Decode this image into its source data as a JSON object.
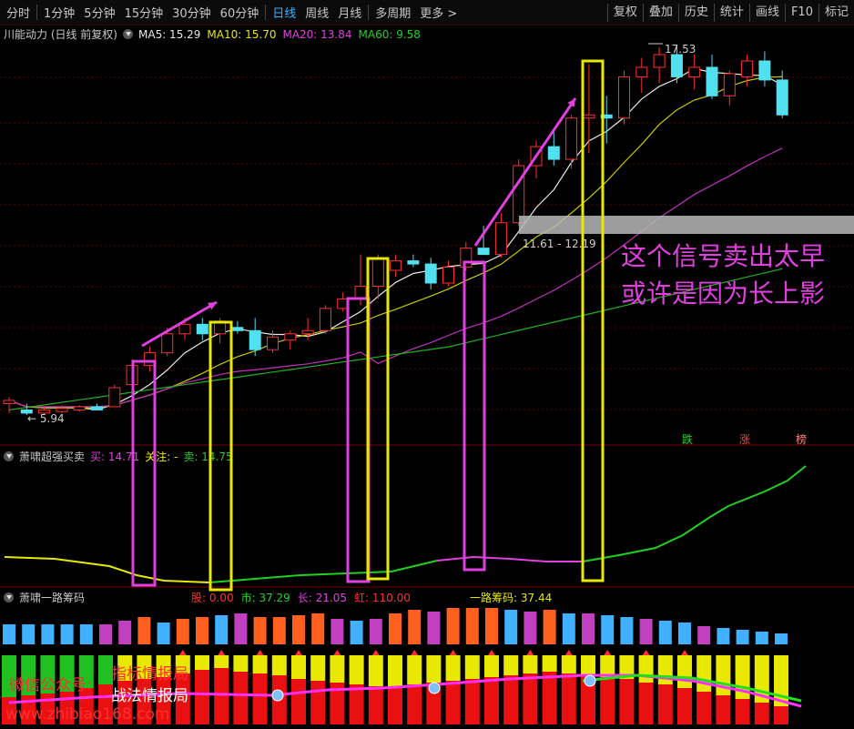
{
  "toolbar": {
    "periods": [
      "分时",
      "1分钟",
      "5分钟",
      "15分钟",
      "30分钟",
      "60分钟",
      "日线",
      "周线",
      "月线",
      "多周期",
      "更多 >"
    ],
    "active_period": "日线",
    "right_buttons": [
      "复权",
      "叠加",
      "历史",
      "统计",
      "画线",
      "F10",
      "标记"
    ]
  },
  "main_panel": {
    "title": "川能动力 (日线 前复权)",
    "ma": [
      {
        "label": "MA5: 15.29",
        "color": "#e8e8e8"
      },
      {
        "label": "MA10: 15.70",
        "color": "#e8e800"
      },
      {
        "label": "MA20: 13.84",
        "color": "#e040e0"
      },
      {
        "label": "MA60: 9.58",
        "color": "#20d020"
      }
    ],
    "high_label": "17.53",
    "low_label": "← 5.94",
    "range_label": "11.61 - 12.19",
    "annotation_line1": "这个信号卖出太早",
    "annotation_line2": "或许是因为长上影",
    "signals": [
      {
        "text": "跌",
        "color": "#20d020"
      },
      {
        "text": "涨",
        "color": "#ff4040"
      },
      {
        "text": "榜",
        "color": "#ff8080"
      }
    ]
  },
  "indicator1": {
    "title": "萧啸超强买卖",
    "values": [
      {
        "text": "买: 14.71",
        "color": "#e040e0"
      },
      {
        "text": "关注: -",
        "color": "#e8e800"
      },
      {
        "text": "卖: 14.75",
        "color": "#20d020"
      }
    ]
  },
  "indicator2": {
    "title": "萧啸一路筹码",
    "values": [
      {
        "text": "股: 0.00",
        "color": "#ff3030"
      },
      {
        "text": "市: 37.29",
        "color": "#20d020"
      },
      {
        "text": "长: 21.05",
        "color": "#e040e0"
      },
      {
        "text": "虹: 110.00",
        "color": "#ff3030"
      }
    ],
    "chips_label": "一路筹码: 37.44"
  },
  "watermark": {
    "wechat": "微信公众号:",
    "line1": "指标情报局",
    "line2": "战法情报局",
    "url": "www.zhibiao168.com"
  },
  "chart_data": {
    "type": "candlestick",
    "candles": [
      [
        6.3,
        6.5,
        6.0,
        6.4
      ],
      [
        6.1,
        6.3,
        5.94,
        6.0
      ],
      [
        6.0,
        6.2,
        5.95,
        6.1
      ],
      [
        6.05,
        6.25,
        6.0,
        6.15
      ],
      [
        6.1,
        6.25,
        6.05,
        6.2
      ],
      [
        6.2,
        6.3,
        6.1,
        6.1
      ],
      [
        6.2,
        6.9,
        6.2,
        6.8
      ],
      [
        6.9,
        7.7,
        6.8,
        7.5
      ],
      [
        7.5,
        8.1,
        7.3,
        7.9
      ],
      [
        7.9,
        8.7,
        7.8,
        8.5
      ],
      [
        8.5,
        9.0,
        8.3,
        8.8
      ],
      [
        8.8,
        9.0,
        8.3,
        8.5
      ],
      [
        8.5,
        9.0,
        8.2,
        8.9
      ],
      [
        8.7,
        8.9,
        8.5,
        8.6
      ],
      [
        8.6,
        9.0,
        7.8,
        8.0
      ],
      [
        8.0,
        8.6,
        7.9,
        8.4
      ],
      [
        8.3,
        8.6,
        8.0,
        8.5
      ],
      [
        8.5,
        9.0,
        8.3,
        8.6
      ],
      [
        8.6,
        9.4,
        8.5,
        9.3
      ],
      [
        9.3,
        9.8,
        9.2,
        9.6
      ],
      [
        9.6,
        11.0,
        9.4,
        10.0
      ],
      [
        10.0,
        11.0,
        9.6,
        10.9
      ],
      [
        10.5,
        11.0,
        10.3,
        10.8
      ],
      [
        10.8,
        11.0,
        10.6,
        10.7
      ],
      [
        10.7,
        10.9,
        9.9,
        10.1
      ],
      [
        10.1,
        10.8,
        10.0,
        10.6
      ],
      [
        10.6,
        11.4,
        10.5,
        11.2
      ],
      [
        11.2,
        11.9,
        11.0,
        11.0
      ],
      [
        11.0,
        12.3,
        10.9,
        12.0
      ],
      [
        12.0,
        14.0,
        11.9,
        13.8
      ],
      [
        13.8,
        14.6,
        13.4,
        14.4
      ],
      [
        14.4,
        14.9,
        13.8,
        14.0
      ],
      [
        14.0,
        15.4,
        13.7,
        15.3
      ],
      [
        15.3,
        17.0,
        14.2,
        15.4
      ],
      [
        15.4,
        16.0,
        14.5,
        15.3
      ],
      [
        15.3,
        16.8,
        15.1,
        16.6
      ],
      [
        16.6,
        17.2,
        16.1,
        16.9
      ],
      [
        16.9,
        17.53,
        16.4,
        17.3
      ],
      [
        17.3,
        17.6,
        16.4,
        16.6
      ],
      [
        16.6,
        17.3,
        16.2,
        16.9
      ],
      [
        16.9,
        17.3,
        15.9,
        16.0
      ],
      [
        16.0,
        16.8,
        15.7,
        16.7
      ],
      [
        16.6,
        17.3,
        16.3,
        17.1
      ],
      [
        17.1,
        17.4,
        16.3,
        16.5
      ],
      [
        16.5,
        16.8,
        15.3,
        15.4
      ]
    ]
  }
}
